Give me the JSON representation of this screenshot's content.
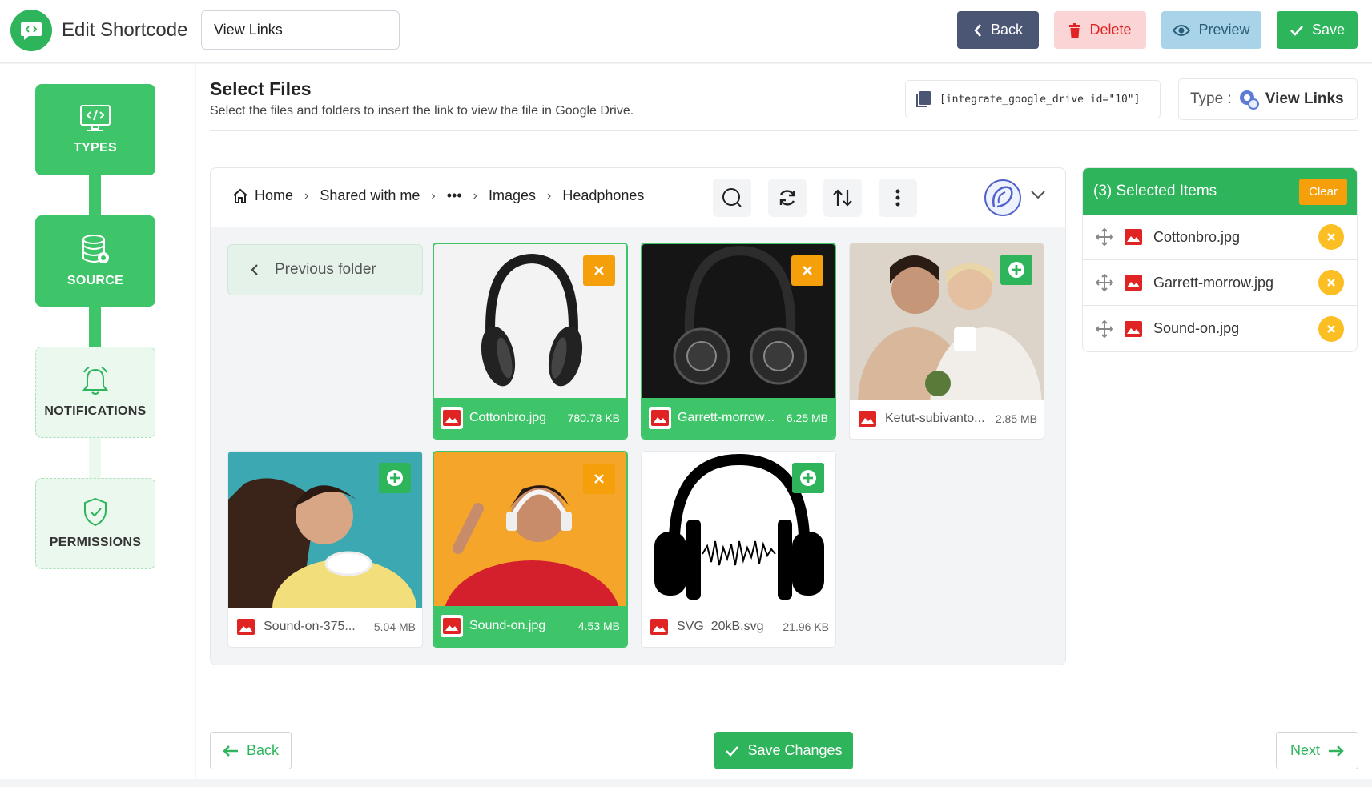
{
  "header": {
    "title": "Edit Shortcode",
    "title_input_value": "View Links",
    "back_label": "Back",
    "delete_label": "Delete",
    "preview_label": "Preview",
    "save_label": "Save"
  },
  "sidebar": {
    "steps": [
      {
        "label": "TYPES",
        "icon": "code-monitor-icon",
        "active": true
      },
      {
        "label": "SOURCE",
        "icon": "database-icon",
        "active": true
      },
      {
        "label": "NOTIFICATIONS",
        "icon": "bell-icon",
        "active": false
      },
      {
        "label": "PERMISSIONS",
        "icon": "shield-check-icon",
        "active": false
      }
    ]
  },
  "main": {
    "title": "Select Files",
    "description": "Select the files and folders to insert the link to view the file in Google Drive.",
    "shortcode": "[integrate_google_drive id=\"10\"]",
    "type_label": "Type :",
    "type_value": "View Links"
  },
  "browser": {
    "breadcrumbs": [
      "Home",
      "Shared with me",
      "•••",
      "Images",
      "Headphones"
    ],
    "previous_folder_label": "Previous folder",
    "files": [
      {
        "name": "Cottonbro.jpg",
        "size": "780.78 KB",
        "selected": true
      },
      {
        "name": "Garrett-morrow...",
        "size": "6.25 MB",
        "selected": true
      },
      {
        "name": "Ketut-subivanto...",
        "size": "2.85 MB",
        "selected": false
      },
      {
        "name": "Sound-on-375...",
        "size": "5.04 MB",
        "selected": false
      },
      {
        "name": "Sound-on.jpg",
        "size": "4.53 MB",
        "selected": true
      },
      {
        "name": "SVG_20kB.svg",
        "size": "21.96 KB",
        "selected": false
      }
    ]
  },
  "selected_panel": {
    "title": "(3) Selected Items",
    "clear_label": "Clear",
    "items": [
      "Cottonbro.jpg",
      "Garrett-morrow.jpg",
      "Sound-on.jpg"
    ]
  },
  "footer": {
    "back_label": "Back",
    "save_changes_label": "Save Changes",
    "next_label": "Next"
  },
  "colors": {
    "accent": "#2eb55c",
    "warning": "#f59f0a",
    "danger": "#e02424",
    "slate": "#4a5674"
  }
}
